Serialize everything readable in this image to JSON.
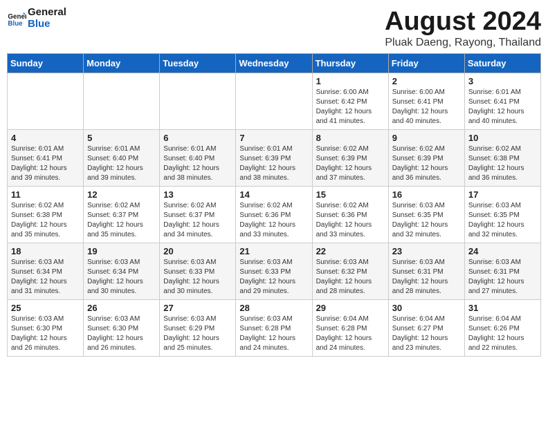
{
  "logo": {
    "line1": "General",
    "line2": "Blue"
  },
  "title": "August 2024",
  "subtitle": "Pluak Daeng, Rayong, Thailand",
  "days_of_week": [
    "Sunday",
    "Monday",
    "Tuesday",
    "Wednesday",
    "Thursday",
    "Friday",
    "Saturday"
  ],
  "weeks": [
    [
      {
        "day": "",
        "info": ""
      },
      {
        "day": "",
        "info": ""
      },
      {
        "day": "",
        "info": ""
      },
      {
        "day": "",
        "info": ""
      },
      {
        "day": "1",
        "info": "Sunrise: 6:00 AM\nSunset: 6:42 PM\nDaylight: 12 hours\nand 41 minutes."
      },
      {
        "day": "2",
        "info": "Sunrise: 6:00 AM\nSunset: 6:41 PM\nDaylight: 12 hours\nand 40 minutes."
      },
      {
        "day": "3",
        "info": "Sunrise: 6:01 AM\nSunset: 6:41 PM\nDaylight: 12 hours\nand 40 minutes."
      }
    ],
    [
      {
        "day": "4",
        "info": "Sunrise: 6:01 AM\nSunset: 6:41 PM\nDaylight: 12 hours\nand 39 minutes."
      },
      {
        "day": "5",
        "info": "Sunrise: 6:01 AM\nSunset: 6:40 PM\nDaylight: 12 hours\nand 39 minutes."
      },
      {
        "day": "6",
        "info": "Sunrise: 6:01 AM\nSunset: 6:40 PM\nDaylight: 12 hours\nand 38 minutes."
      },
      {
        "day": "7",
        "info": "Sunrise: 6:01 AM\nSunset: 6:39 PM\nDaylight: 12 hours\nand 38 minutes."
      },
      {
        "day": "8",
        "info": "Sunrise: 6:02 AM\nSunset: 6:39 PM\nDaylight: 12 hours\nand 37 minutes."
      },
      {
        "day": "9",
        "info": "Sunrise: 6:02 AM\nSunset: 6:39 PM\nDaylight: 12 hours\nand 36 minutes."
      },
      {
        "day": "10",
        "info": "Sunrise: 6:02 AM\nSunset: 6:38 PM\nDaylight: 12 hours\nand 36 minutes."
      }
    ],
    [
      {
        "day": "11",
        "info": "Sunrise: 6:02 AM\nSunset: 6:38 PM\nDaylight: 12 hours\nand 35 minutes."
      },
      {
        "day": "12",
        "info": "Sunrise: 6:02 AM\nSunset: 6:37 PM\nDaylight: 12 hours\nand 35 minutes."
      },
      {
        "day": "13",
        "info": "Sunrise: 6:02 AM\nSunset: 6:37 PM\nDaylight: 12 hours\nand 34 minutes."
      },
      {
        "day": "14",
        "info": "Sunrise: 6:02 AM\nSunset: 6:36 PM\nDaylight: 12 hours\nand 33 minutes."
      },
      {
        "day": "15",
        "info": "Sunrise: 6:02 AM\nSunset: 6:36 PM\nDaylight: 12 hours\nand 33 minutes."
      },
      {
        "day": "16",
        "info": "Sunrise: 6:03 AM\nSunset: 6:35 PM\nDaylight: 12 hours\nand 32 minutes."
      },
      {
        "day": "17",
        "info": "Sunrise: 6:03 AM\nSunset: 6:35 PM\nDaylight: 12 hours\nand 32 minutes."
      }
    ],
    [
      {
        "day": "18",
        "info": "Sunrise: 6:03 AM\nSunset: 6:34 PM\nDaylight: 12 hours\nand 31 minutes."
      },
      {
        "day": "19",
        "info": "Sunrise: 6:03 AM\nSunset: 6:34 PM\nDaylight: 12 hours\nand 30 minutes."
      },
      {
        "day": "20",
        "info": "Sunrise: 6:03 AM\nSunset: 6:33 PM\nDaylight: 12 hours\nand 30 minutes."
      },
      {
        "day": "21",
        "info": "Sunrise: 6:03 AM\nSunset: 6:33 PM\nDaylight: 12 hours\nand 29 minutes."
      },
      {
        "day": "22",
        "info": "Sunrise: 6:03 AM\nSunset: 6:32 PM\nDaylight: 12 hours\nand 28 minutes."
      },
      {
        "day": "23",
        "info": "Sunrise: 6:03 AM\nSunset: 6:31 PM\nDaylight: 12 hours\nand 28 minutes."
      },
      {
        "day": "24",
        "info": "Sunrise: 6:03 AM\nSunset: 6:31 PM\nDaylight: 12 hours\nand 27 minutes."
      }
    ],
    [
      {
        "day": "25",
        "info": "Sunrise: 6:03 AM\nSunset: 6:30 PM\nDaylight: 12 hours\nand 26 minutes."
      },
      {
        "day": "26",
        "info": "Sunrise: 6:03 AM\nSunset: 6:30 PM\nDaylight: 12 hours\nand 26 minutes."
      },
      {
        "day": "27",
        "info": "Sunrise: 6:03 AM\nSunset: 6:29 PM\nDaylight: 12 hours\nand 25 minutes."
      },
      {
        "day": "28",
        "info": "Sunrise: 6:03 AM\nSunset: 6:28 PM\nDaylight: 12 hours\nand 24 minutes."
      },
      {
        "day": "29",
        "info": "Sunrise: 6:04 AM\nSunset: 6:28 PM\nDaylight: 12 hours\nand 24 minutes."
      },
      {
        "day": "30",
        "info": "Sunrise: 6:04 AM\nSunset: 6:27 PM\nDaylight: 12 hours\nand 23 minutes."
      },
      {
        "day": "31",
        "info": "Sunrise: 6:04 AM\nSunset: 6:26 PM\nDaylight: 12 hours\nand 22 minutes."
      }
    ]
  ]
}
